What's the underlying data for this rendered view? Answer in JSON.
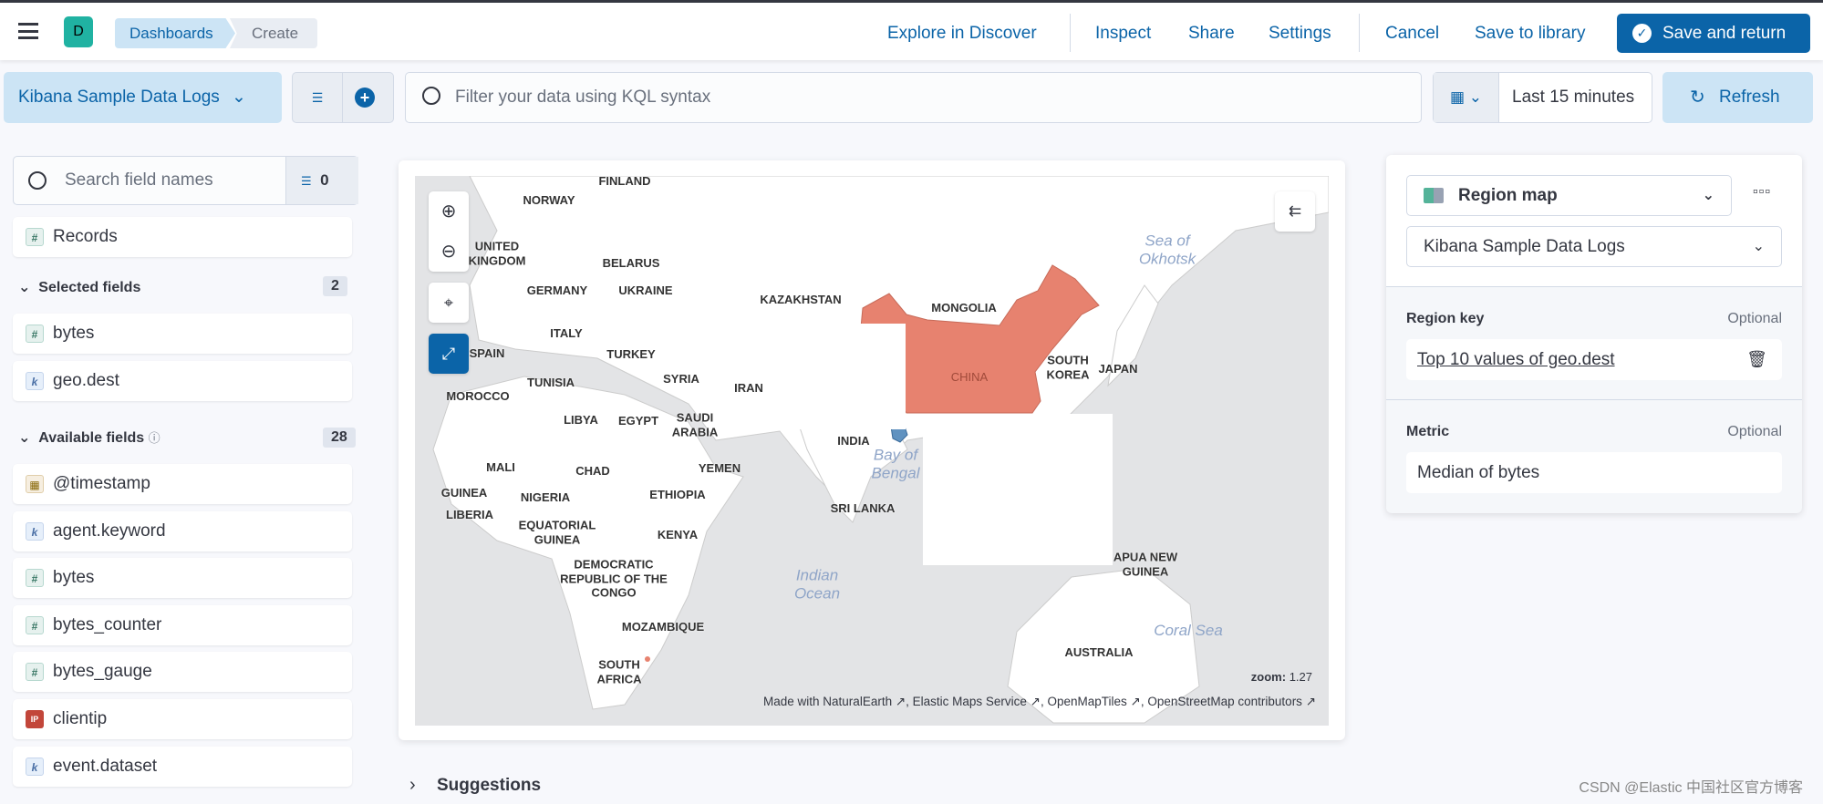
{
  "header": {
    "avatar": "D",
    "breadcrumbs": [
      "Dashboards",
      "Create"
    ],
    "links": {
      "explore": "Explore in Discover",
      "inspect": "Inspect",
      "share": "Share",
      "settings": "Settings",
      "cancel": "Cancel",
      "save_library": "Save to library"
    },
    "save_return": "Save and return",
    "accent": "#0b64a8"
  },
  "query": {
    "data_view": "Kibana Sample Data Logs",
    "placeholder": "Filter your data using KQL syntax",
    "time": "Last 15 minutes",
    "refresh": "Refresh"
  },
  "sidebar": {
    "search_placeholder": "Search field names",
    "filter_count": "0",
    "records": "Records",
    "selected_label": "Selected fields",
    "selected_count": "2",
    "selected": [
      {
        "name": "bytes",
        "type": "number"
      },
      {
        "name": "geo.dest",
        "type": "keyword"
      }
    ],
    "available_label": "Available fields",
    "available_count": "28",
    "available": [
      {
        "name": "@timestamp",
        "type": "date"
      },
      {
        "name": "agent.keyword",
        "type": "keyword"
      },
      {
        "name": "bytes",
        "type": "number"
      },
      {
        "name": "bytes_counter",
        "type": "number"
      },
      {
        "name": "bytes_gauge",
        "type": "number"
      },
      {
        "name": "clientip",
        "type": "ip"
      },
      {
        "name": "event.dataset",
        "type": "keyword"
      }
    ],
    "type_glyphs": {
      "number": "#",
      "keyword": "k",
      "date": "▦",
      "ip": "IP"
    }
  },
  "map": {
    "labels": [
      "FINLAND",
      "NORWAY",
      "UNITED KINGDOM",
      "BELARUS",
      "GERMANY",
      "UKRAINE",
      "KAZAKHSTAN",
      "MONGOLIA",
      "ITALY",
      "SPAIN",
      "TURKEY",
      "SOUTH KOREA",
      "JAPAN",
      "CHINA",
      "TUNISIA",
      "SYRIA",
      "IRAN",
      "MOROCCO",
      "LIBYA",
      "EGYPT",
      "SAUDI ARABIA",
      "INDIA",
      "YEMEN",
      "MALI",
      "CHAD",
      "GUINEA",
      "NIGERIA",
      "ETHIOPIA",
      "LIBERIA",
      "SRI LANKA",
      "EQUATORIAL GUINEA",
      "KENYA",
      "APUA NEW GUINEA",
      "DEMOCRATIC REPUBLIC OF THE CONGO",
      "MOZAMBIQUE",
      "AUSTRALIA",
      "SOUTH AFRICA"
    ],
    "seas": [
      "Sea of Okhotsk",
      "Bay of Bengal",
      "Indian Ocean",
      "Coral Sea"
    ],
    "zoom_label": "zoom:",
    "zoom_value": "1.27",
    "attribution": "Made with NaturalEarth ↗, Elastic Maps Service ↗, OpenMapTiles ↗, OpenStreetMap contributors ↗",
    "highlight_color": "#e7826f",
    "secondary_color": "#6092c0"
  },
  "suggestions": "Suggestions",
  "config": {
    "vis_type": "Region map",
    "data_view": "Kibana Sample Data Logs",
    "region_key_label": "Region key",
    "region_key_optional": "Optional",
    "region_key_value": "Top 10 values of geo.dest",
    "metric_label": "Metric",
    "metric_optional": "Optional",
    "metric_value": "Median of bytes"
  },
  "watermark": "CSDN @Elastic 中国社区官方博客"
}
